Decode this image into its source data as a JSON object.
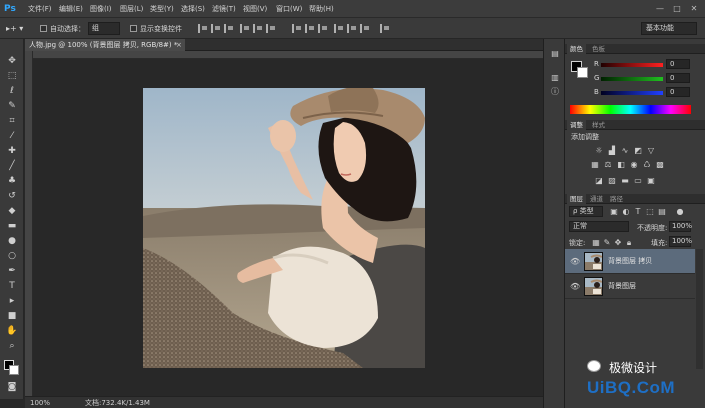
{
  "menubar": {
    "logo": "Ps",
    "items": [
      "文件(F)",
      "编辑(E)",
      "图像(I)",
      "图层(L)",
      "类型(Y)",
      "选择(S)",
      "滤镜(T)",
      "视图(V)",
      "窗口(W)",
      "帮助(H)"
    ],
    "window_controls": [
      "—",
      "□",
      "✕"
    ]
  },
  "options": {
    "auto_select_label": "自动选择：",
    "auto_select_value": "组",
    "show_transform_label": "显示变换控件",
    "workspace": "基本功能"
  },
  "document": {
    "tab_title": "人物.jpg @ 100% (背景图层 拷贝, RGB/8#) *",
    "tab_close": "×",
    "zoom": "100%",
    "doc_info": "文档:732.4K/1.43M"
  },
  "panels": {
    "color": {
      "tabs": [
        "颜色",
        "色板"
      ],
      "channels": [
        {
          "label": "R",
          "value": "0",
          "color": "#ff2020"
        },
        {
          "label": "G",
          "value": "0",
          "color": "#20c020"
        },
        {
          "label": "B",
          "value": "0",
          "color": "#2040ff"
        }
      ]
    },
    "adjustments": {
      "tabs": [
        "调整",
        "样式"
      ],
      "title": "添加调整"
    },
    "layers": {
      "tabs": [
        "图层",
        "通道",
        "路径"
      ],
      "filter_kind": "ρ 类型",
      "blend_mode": "正常",
      "opacity_label": "不透明度:",
      "opacity_value": "100%",
      "lock_label": "锁定:",
      "fill_label": "填充:",
      "fill_value": "100%",
      "items": [
        {
          "name": "背景图层 拷贝",
          "selected": true
        },
        {
          "name": "背景图层",
          "selected": false
        }
      ]
    }
  },
  "watermark": {
    "text": "极微设计",
    "site": "UiBQ.CoM"
  }
}
